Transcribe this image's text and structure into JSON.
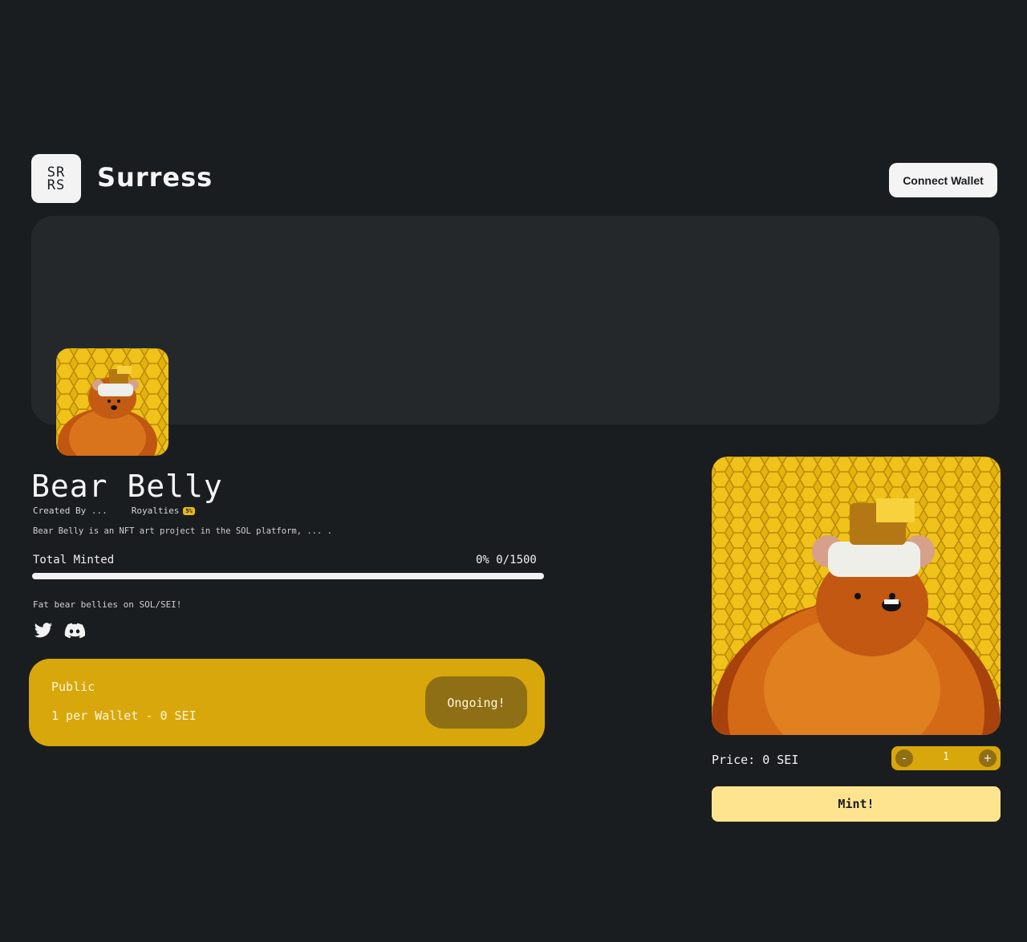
{
  "colors": {
    "background": "#1a1d20",
    "banner": "#25282b",
    "accent": "#d8a70c",
    "accent_dark": "#8f6f16",
    "mint_button": "#ffe48f"
  },
  "header": {
    "logo_line1": "SR",
    "logo_line2": "RS",
    "brand": "Surress",
    "connect_label": "Connect Wallet"
  },
  "collection": {
    "title": "Bear Belly",
    "created_by": "Created By ...",
    "royalties_label": "Royalties",
    "royalties_badge": "5%",
    "description": "Bear Belly is an NFT art project in the SOL platform, ... .",
    "minted_label": "Total Minted",
    "minted_count": "0% 0/1500",
    "minted_fraction": 0,
    "tagline": "Fat bear bellies on SOL/SEI!",
    "socials": [
      "twitter-icon",
      "discord-icon"
    ]
  },
  "phase": {
    "name": "Public",
    "info": "1 per Wallet - 0 SEI",
    "status": "Ongoing!"
  },
  "mint": {
    "price": "Price: 0 SEI",
    "minus": "-",
    "plus": "+",
    "quantity": "1",
    "button": "Mint!"
  }
}
